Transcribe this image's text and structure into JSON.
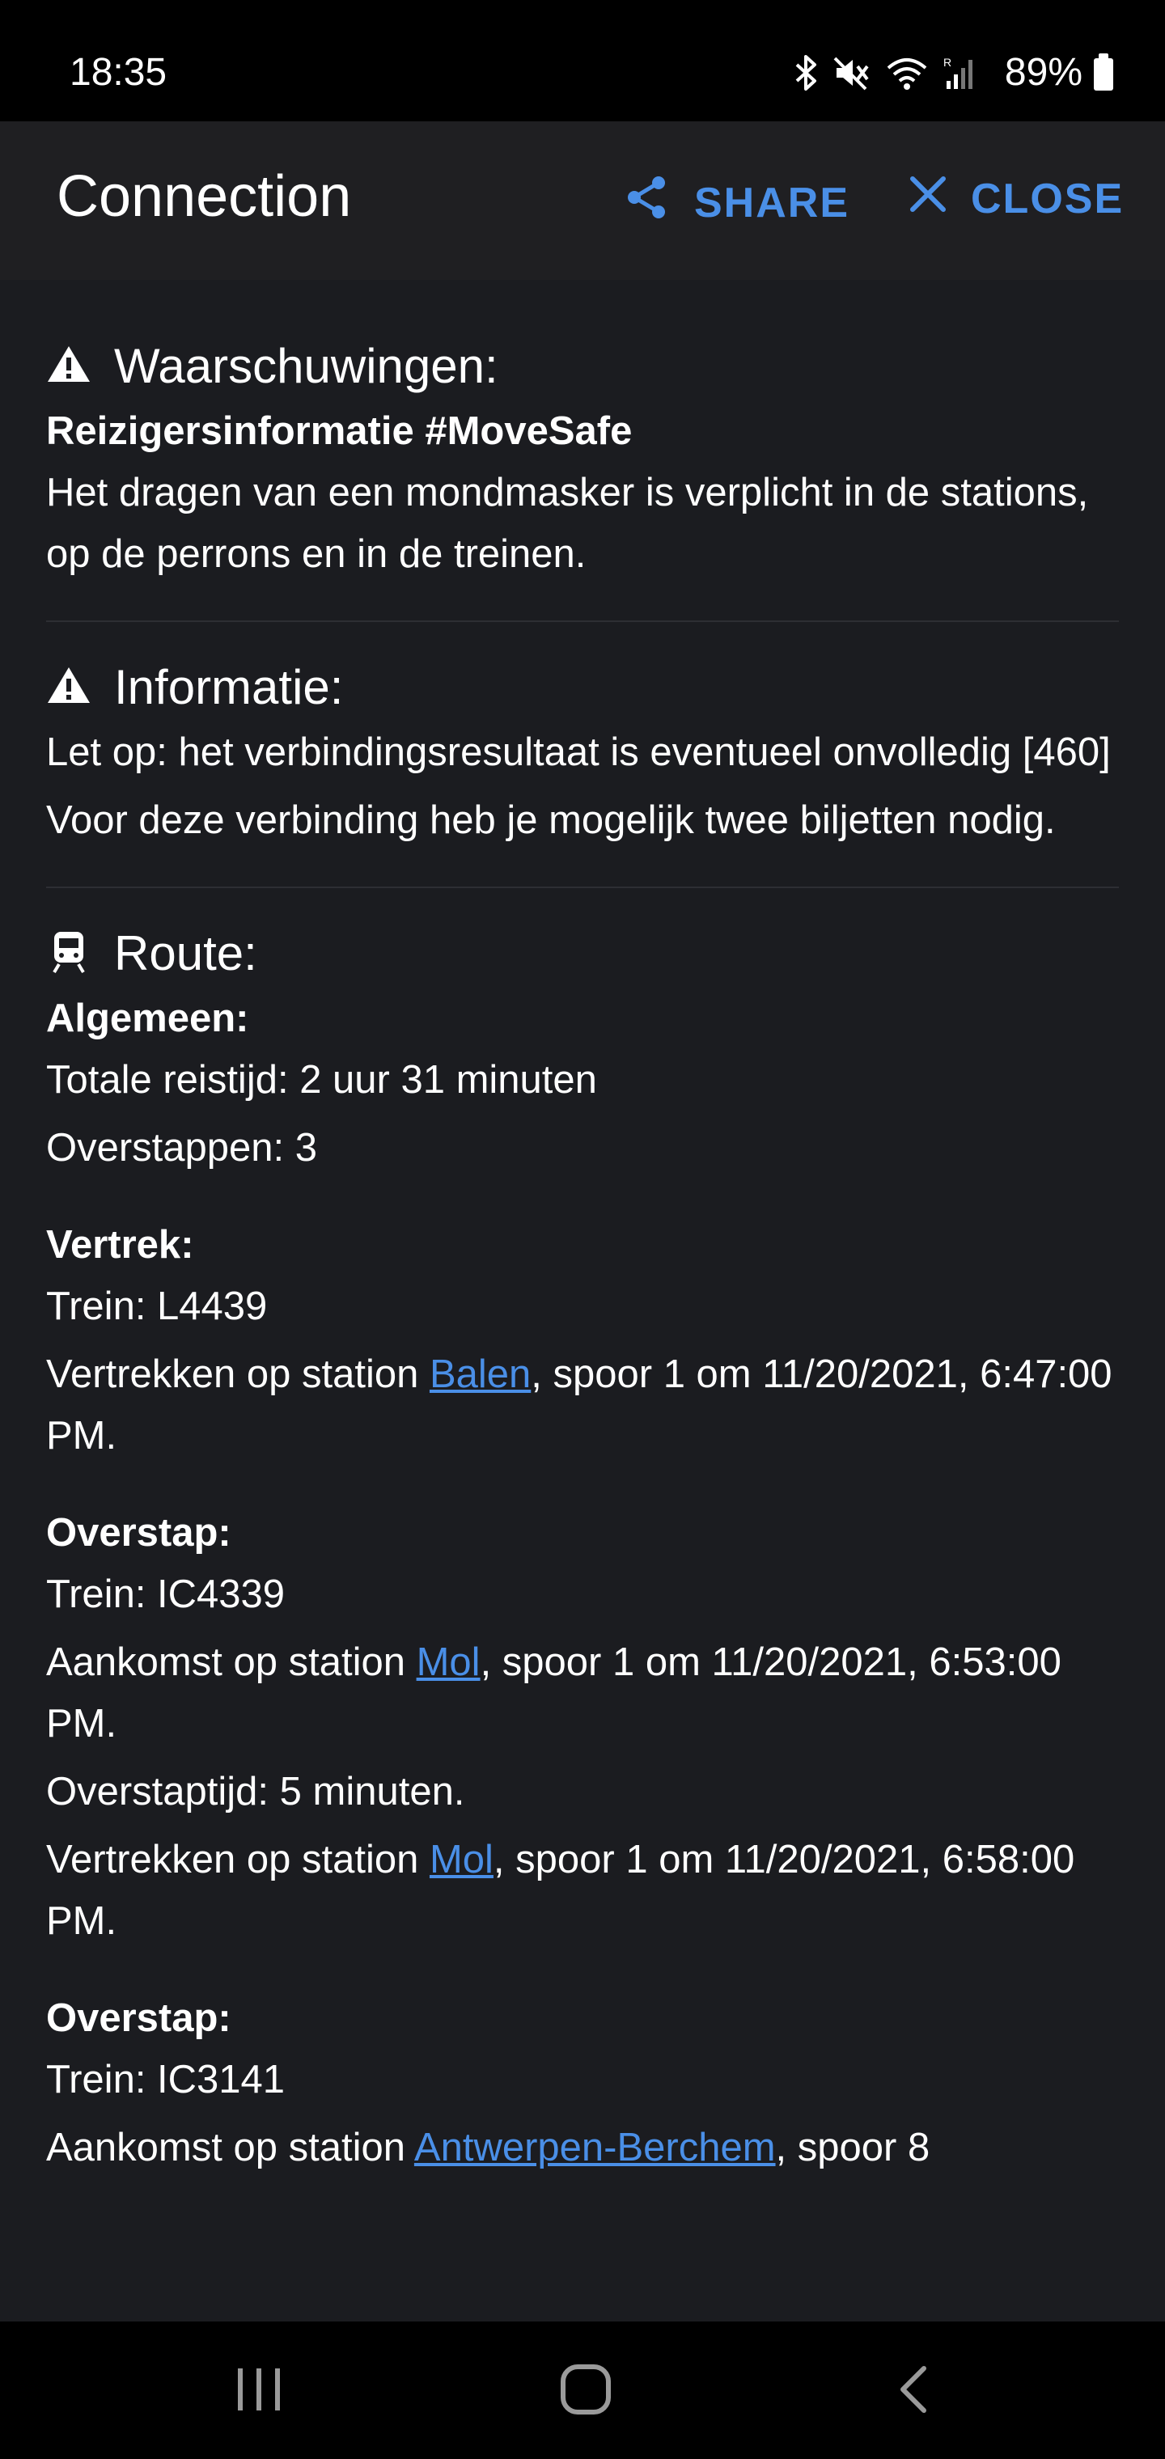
{
  "status": {
    "time": "18:35",
    "battery": "89%"
  },
  "app_bar": {
    "title": "Connection",
    "share_label": "SHARE",
    "close_label": "CLOSE"
  },
  "warnings": {
    "title": "Waarschuwingen:",
    "heading": "Reizigersinformatie #MoveSafe",
    "text": "Het dragen van een mondmasker is verplicht in de stations, op de perrons en in de treinen."
  },
  "info": {
    "title": "Informatie:",
    "lines": [
      "Let op: het verbindingsresultaat is eventueel onvolledig [460]",
      "Voor deze verbinding heb je mogelijk twee biljetten nodig."
    ]
  },
  "route": {
    "title": "Route:",
    "general": {
      "label": "Algemeen:",
      "total": "Totale reistijd: 2 uur 31 minuten",
      "transfers": "Overstappen: 3"
    },
    "departure": {
      "label": "Vertrek:",
      "train": "Trein: L4439",
      "depart_prefix": "Vertrekken op station ",
      "depart_station": "Balen",
      "depart_suffix": ", spoor 1 om 11/20/2021, 6:47:00 PM."
    },
    "transfer1": {
      "label": "Overstap:",
      "train": "Trein: IC4339",
      "arrive_prefix": "Aankomst op station ",
      "arrive_station": "Mol",
      "arrive_suffix": ", spoor 1 om 11/20/2021, 6:53:00 PM.",
      "transfer_time": "Overstaptijd: 5 minuten.",
      "depart_prefix": "Vertrekken op station ",
      "depart_station": "Mol",
      "depart_suffix": ", spoor 1 om 11/20/2021, 6:58:00 PM."
    },
    "transfer2": {
      "label": "Overstap:",
      "train": "Trein: IC3141",
      "arrive_prefix": "Aankomst op station ",
      "arrive_station": "Antwerpen-Berchem",
      "arrive_suffix": ", spoor 8"
    }
  },
  "colors": {
    "accent": "#4a8fe7",
    "background": "#1b1c20",
    "app_bar": "#1f1f22"
  }
}
